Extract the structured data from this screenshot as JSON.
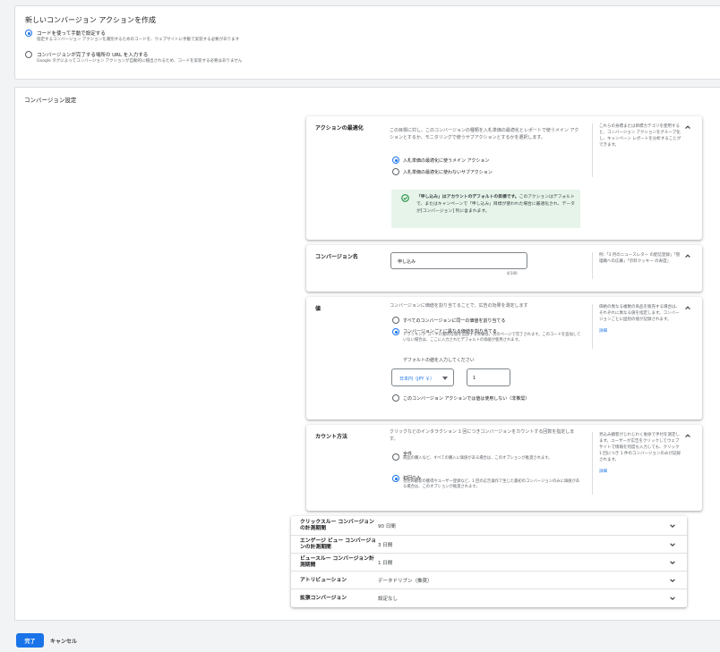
{
  "top": {
    "title": "新しいコンバージョン アクションを作成",
    "options": [
      {
        "label": "コードを使って手動で設定する",
        "desc": "指定するコンバージョン アクションを識別するためのコードを、ウェブサイトに手動で実装する必要があります",
        "checked": true
      },
      {
        "label": "コンバージョンが完了する場所の URL を入力する",
        "desc": "Google タグによってコンバージョン アクションが自動的に検出されるため、コードを実装する必要はありません",
        "checked": false
      }
    ]
  },
  "settings": {
    "title": "コンバージョン設定",
    "optimization": {
      "label": "アクションの最適化",
      "desc": "この目標に対し、このコンバージョンの種類を入札単価の最適化とレポートで使うメイン アクションとするか、モニタリングで使うサブアクションとするかを選択します。",
      "options": [
        "入札単価の最適化に使うメイン アクション",
        "入札単価の最適化に使わないサブアクション"
      ],
      "notice_bold": "「申し込み」はアカウントのデフォルトの目標です。",
      "notice_rest": "このアクションはデフォルトで、またはキャンペーンで「申し込み」目標が使われた場合に最適化され、データが[コンバージョン] 列に含まれます。",
      "help": "これらの身標または目標カテゴリを使用すると、コンバージョン アクションをグループ化し、キャンペーン レポートを分析することができます。"
    },
    "name": {
      "label": "コンバージョン名",
      "value": "申し込み",
      "counter": "4/100",
      "help": "例:「&#34;3 月のニュースレター の配信登録&#34;」「&#34;管理職への応募&#34;」「&#34;示料クッキー の寿度&#34;」"
    },
    "value": {
      "label": "値",
      "desc": "コンバージョンに価値を割り当てることで、広告の効果を測定します",
      "opt1": "すべてのコンバージョンに同一の価値を割り当てる",
      "opt2": "コンバージョンごとに異なる価値を割り当てる",
      "opt2_desc": "トラッキング コードに動的な値を追加する準備は、次のページで完了されます。このコードを追加していない場合は、ここに入力されたデフォルトの価値が使用されます。",
      "default_label": "デフォルトの値を入力してください",
      "currency": "日本円（JPY ￥）",
      "amount": "1",
      "opt3": "このコンバージョン アクションでは値は使用しない（非推奨）",
      "help": "価格の異なる複数の商品を販売する場合は、それぞれに異なる値を指定します。コンバージョンごとに固別の値が記録されます。",
      "help_link": "詳細"
    },
    "count": {
      "label": "カウント方法",
      "desc": "クリックなどのインタラクション 1 回につきコンバージョンをカウントする回数を指定します。",
      "opt1": "全件",
      "opt1_desc": "商品の購入など、すべての購入に価値がある場合は、このオプションが推奨されます。",
      "opt2": "初回のみ",
      "opt2_desc": "見込み顧客の獲得やユーザー登録など、1 回の広告操作で生じた最初のコンバージョンのみに価値がある場合は、このオプションが推奨されます。",
      "help": "見込み顧客がじわじわく後徐で手付を測定します。ユーザーが広告をクリックしてウェブサイトで情報を何度も入力しても、クリック 1 回につき 1 件のコンバージョンのみが記録されます。",
      "help_link": "詳細"
    },
    "rows": [
      {
        "label": "クリックスルー コンバージョンの計測期間",
        "value": "90 日間"
      },
      {
        "label": "エンゲージ ビュー コンバージョンの計測期間",
        "value": "3 日間"
      },
      {
        "label": "ビュースルー コンバージョン計測期間",
        "value": "1 日間"
      },
      {
        "label": "アトリビューション",
        "value": "データドリブン（推奨）"
      },
      {
        "label": "拡張コンバージョン",
        "value": "設定なし"
      }
    ]
  },
  "footer": {
    "done": "完了",
    "cancel": "キャンセル"
  },
  "colors": {
    "accent": "#1a73e8",
    "success": "#1e8e3e",
    "notice_bg": "#e6f4ea"
  }
}
